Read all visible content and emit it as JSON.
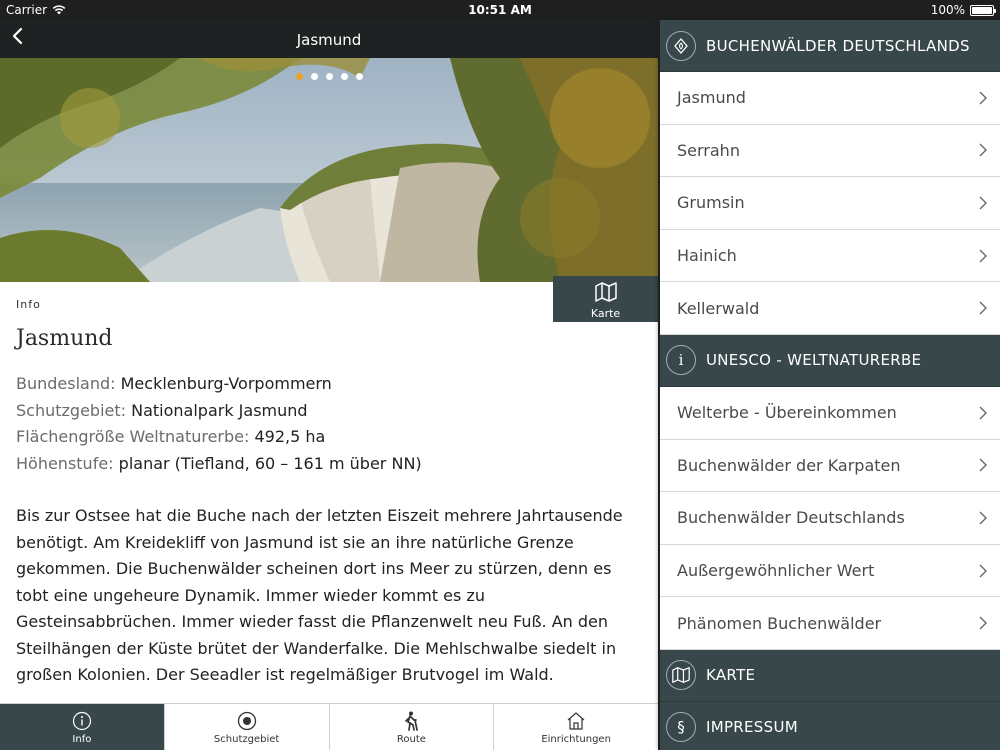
{
  "status": {
    "carrier": "Carrier",
    "time": "10:51 AM",
    "battery": "100%"
  },
  "nav": {
    "title": "Jasmund"
  },
  "hero": {
    "slides": 5,
    "active_slide": 0
  },
  "map_button": {
    "label": "Karte"
  },
  "info": {
    "section_label": "Info",
    "title": "Jasmund",
    "facts": [
      {
        "key": "Bundesland:",
        "value": "Mecklenburg-Vorpommern"
      },
      {
        "key": "Schutzgebiet:",
        "value": "Nationalpark Jasmund"
      },
      {
        "key": "Flächengröße Weltnaturerbe:",
        "value": "492,5 ha"
      },
      {
        "key": "Höhenstufe:",
        "value": "planar (Tiefland, 60 – 161 m über NN)"
      }
    ],
    "description": "Bis zur Ostsee hat die Buche nach der letzten Eiszeit mehrere Jahrtausende benötigt. Am Kreidekliff von Jasmund ist sie an ihre natürliche Grenze gekommen. Die Buchenwälder scheinen dort ins Meer zu stürzen, denn es tobt eine ungeheure Dynamik. Immer wieder kommt es zu Gesteinsabbrüchen. Immer wieder fasst die Pflanzenwelt neu Fuß. An den Steilhängen der Küste brütet der Wanderfalke. Die Mehlschwalbe siedelt in großen Kolonien. Der Seeadler ist regelmäßiger Brutvogel im Wald."
  },
  "tabs": [
    {
      "label": "Info",
      "icon": "info-icon",
      "active": true
    },
    {
      "label": "Schutzgebiet",
      "icon": "target-icon",
      "active": false
    },
    {
      "label": "Route",
      "icon": "hiker-icon",
      "active": false
    },
    {
      "label": "Einrichtungen",
      "icon": "house-icon",
      "active": false
    }
  ],
  "menu": {
    "section1": {
      "title": "BUCHENWÄLDER DEUTSCHLANDS",
      "icon": "forest-badge-icon"
    },
    "section1_items": [
      "Jasmund",
      "Serrahn",
      "Grumsin",
      "Hainich",
      "Kellerwald"
    ],
    "section2": {
      "title": "UNESCO - WELTNATURERBE",
      "icon": "info-icon"
    },
    "section2_items": [
      "Welterbe - Übereinkommen",
      "Buchenwälder der Karpaten",
      "Buchenwälder Deutschlands",
      "Außergewöhnlicher Wert",
      "Phänomen Buchenwälder"
    ],
    "section3": {
      "title": "KARTE",
      "icon": "map-icon"
    },
    "section4": {
      "title": "IMPRESSUM",
      "icon": "paragraph-icon"
    }
  },
  "colors": {
    "dark_bar": "#1e2223",
    "accent_slate": "#37474a",
    "dot_active": "#e8a320"
  }
}
